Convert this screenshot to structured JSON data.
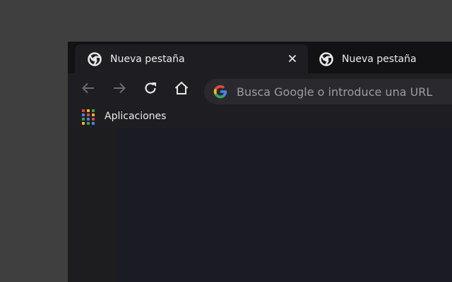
{
  "tabs": [
    {
      "title": "Nueva pestaña",
      "active": true
    },
    {
      "title": "Nueva pestaña",
      "active": false
    }
  ],
  "icons": {
    "favicon": "chrome-icon",
    "close": "close-icon",
    "back": "back-arrow-icon",
    "forward": "forward-arrow-icon",
    "reload": "reload-icon",
    "home": "home-icon",
    "google": "google-icon",
    "apps": "apps-grid-icon"
  },
  "omnibox": {
    "placeholder": "Busca Google o introduce una URL"
  },
  "bookmarks": {
    "items": [
      {
        "label": "Aplicaciones"
      }
    ]
  },
  "colors": {
    "desktop": "#3f3f3f",
    "tabstrip": "#121214",
    "toolbar": "#1e1e22",
    "omnibox": "#2a2a2e",
    "content": "#1b1b24",
    "text": "#ececec",
    "placeholder": "#9a9ca3"
  }
}
